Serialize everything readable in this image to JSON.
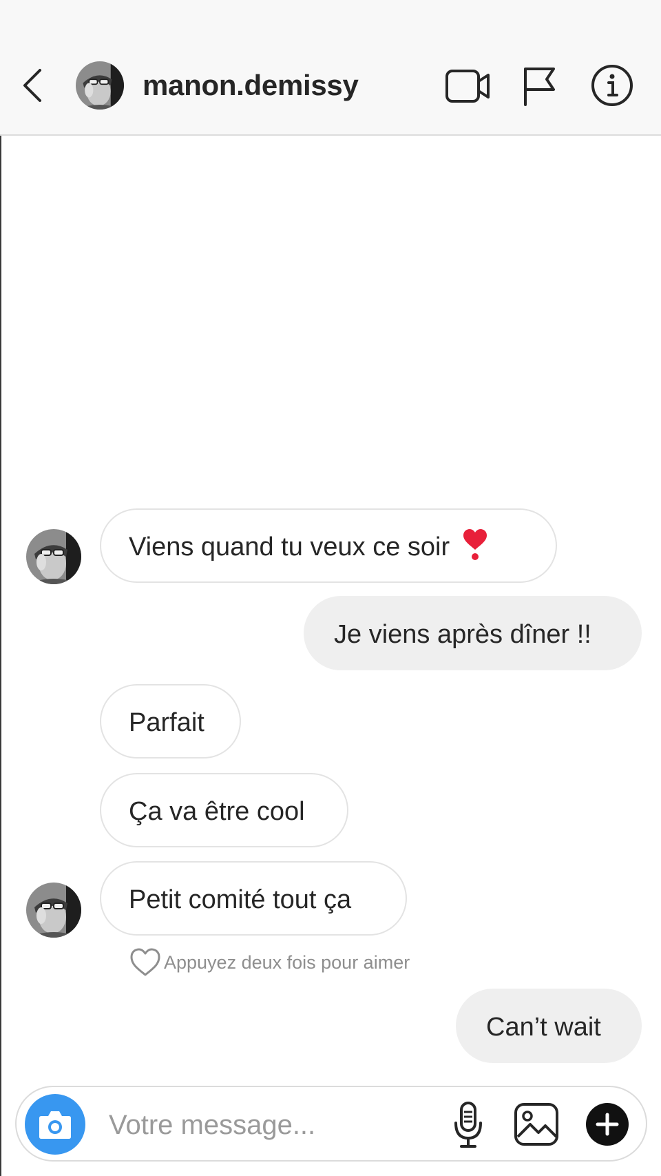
{
  "header": {
    "username": "manon.demissy",
    "icons": [
      "chevron-left-icon",
      "video-camera-icon",
      "flag-icon",
      "info-icon"
    ]
  },
  "messages": [
    {
      "side": "incoming",
      "text": "Viens quand tu veux ce soir",
      "emoji": "heavy-heart-exclamation",
      "avatar": true
    },
    {
      "side": "outgoing",
      "text": "Je viens après dîner !!"
    },
    {
      "side": "incoming",
      "text": "Parfait"
    },
    {
      "side": "incoming",
      "text": "Ça va être cool"
    },
    {
      "side": "incoming",
      "text": "Petit comité tout ça",
      "avatar": true
    },
    {
      "side": "outgoing",
      "text": "Can’t wait"
    }
  ],
  "like_hint": "Appuyez deux fois pour aimer",
  "composer": {
    "placeholder": "Votre message...",
    "icons": [
      "camera-icon",
      "microphone-icon",
      "gallery-icon",
      "plus-icon"
    ]
  },
  "colors": {
    "accent": "#3897f0",
    "outgoing_bubble": "#efefef",
    "incoming_border": "#e3e3e3",
    "header_bg": "#f8f8f8",
    "heart_emoji": "#e8203a"
  }
}
